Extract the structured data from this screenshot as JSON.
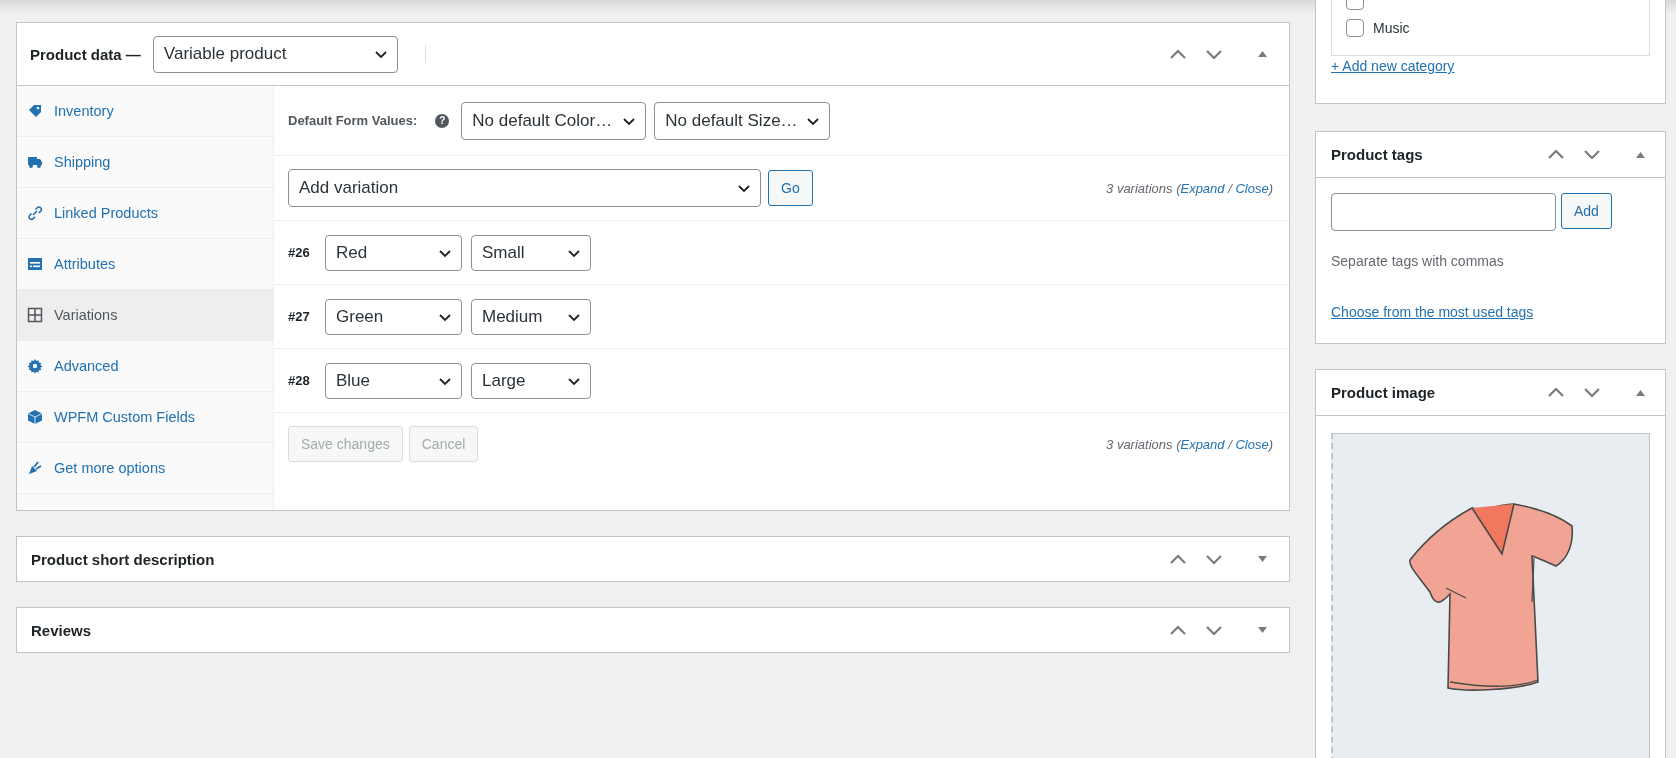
{
  "product_data": {
    "title": "Product data —",
    "product_type": "Variable product",
    "expanded": true,
    "tabs": [
      {
        "label": "Inventory",
        "selected": false
      },
      {
        "label": "Shipping",
        "selected": false
      },
      {
        "label": "Linked Products",
        "selected": false
      },
      {
        "label": "Attributes",
        "selected": false
      },
      {
        "label": "Variations",
        "selected": true
      },
      {
        "label": "Advanced",
        "selected": false
      },
      {
        "label": "WPFM Custom Fields",
        "selected": false
      },
      {
        "label": "Get more options",
        "selected": false
      }
    ],
    "default_form_values": {
      "label": "Default Form Values:",
      "help_icon": "?",
      "selects": [
        "No default Color…",
        "No default Size…"
      ]
    },
    "add_variation": {
      "select": "Add variation",
      "button": "Go"
    },
    "summary_top": [
      {
        "kind": "text",
        "text": "3 variations ("
      },
      {
        "kind": "link",
        "text": "Expand"
      },
      {
        "kind": "text",
        "text": " / "
      },
      {
        "kind": "link",
        "text": "Close"
      },
      {
        "kind": "text",
        "text": ")"
      }
    ],
    "variations": [
      {
        "id": "#26",
        "values": [
          "Red",
          "Small"
        ]
      },
      {
        "id": "#27",
        "values": [
          "Green",
          "Medium"
        ]
      },
      {
        "id": "#28",
        "values": [
          "Blue",
          "Large"
        ]
      }
    ],
    "buttons": [
      {
        "label": "Save changes",
        "disabled": true
      },
      {
        "label": "Cancel",
        "disabled": true
      }
    ],
    "summary_bottom": [
      {
        "kind": "text",
        "text": "3 variations ("
      },
      {
        "kind": "link",
        "text": "Expand"
      },
      {
        "kind": "text",
        "text": " / "
      },
      {
        "kind": "link",
        "text": "Close"
      },
      {
        "kind": "text",
        "text": ")"
      }
    ]
  },
  "sections": [
    {
      "title": "Product short description",
      "expanded": false
    },
    {
      "title": "Reviews",
      "expanded": false
    }
  ],
  "sidebar": {
    "categories": {
      "items": [
        {
          "checked": false
        },
        {
          "label": "Music",
          "checked": false
        }
      ],
      "add_link": "+ Add new category"
    },
    "product_tags": {
      "title": "Product tags",
      "expanded": true,
      "button": "Add",
      "hint": "Separate tags with commas",
      "link": "Choose from the most used tags"
    },
    "product_image": {
      "title": "Product image",
      "expanded": true
    }
  }
}
